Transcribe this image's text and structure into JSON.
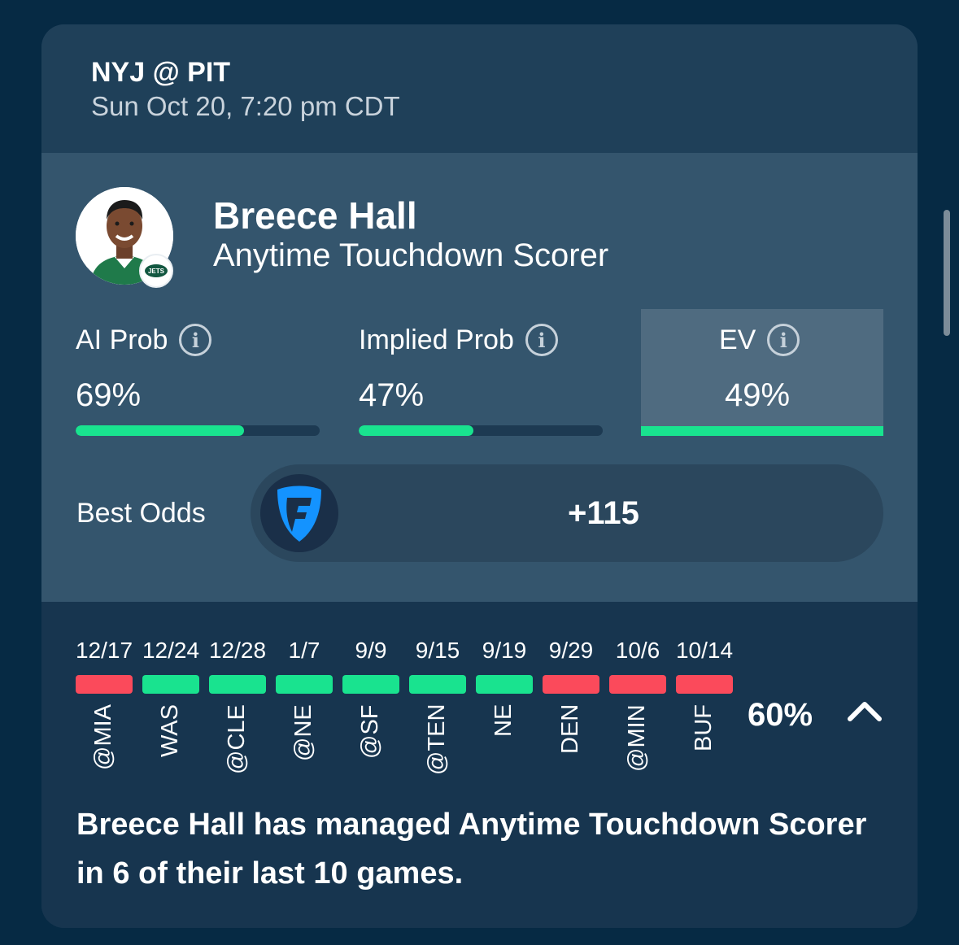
{
  "game": {
    "matchup": "NYJ @ PIT",
    "datetime": "Sun Oct 20, 7:20 pm CDT"
  },
  "player": {
    "name": "Breece Hall",
    "market": "Anytime Touchdown Scorer",
    "team_badge": "JETS"
  },
  "stats": {
    "ai_prob": {
      "label": "AI Prob",
      "value": "69%",
      "fraction": 0.69
    },
    "implied_prob": {
      "label": "Implied Prob",
      "value": "47%",
      "fraction": 0.47
    },
    "ev": {
      "label": "EV",
      "value": "49%",
      "fraction": 1.0
    }
  },
  "odds": {
    "label": "Best Odds",
    "value": "+115",
    "book_icon": "fanduel-shield-icon"
  },
  "history": {
    "games": [
      {
        "date": "12/17",
        "opponent": "@MIA",
        "result": "miss"
      },
      {
        "date": "12/24",
        "opponent": "WAS",
        "result": "hit"
      },
      {
        "date": "12/28",
        "opponent": "@CLE",
        "result": "hit"
      },
      {
        "date": "1/7",
        "opponent": "@NE",
        "result": "hit"
      },
      {
        "date": "9/9",
        "opponent": "@SF",
        "result": "hit"
      },
      {
        "date": "9/15",
        "opponent": "@TEN",
        "result": "hit"
      },
      {
        "date": "9/19",
        "opponent": "NE",
        "result": "hit"
      },
      {
        "date": "9/29",
        "opponent": "DEN",
        "result": "miss"
      },
      {
        "date": "10/6",
        "opponent": "@MIN",
        "result": "miss"
      },
      {
        "date": "10/14",
        "opponent": "BUF",
        "result": "miss"
      }
    ],
    "hit_rate": "60%",
    "summary": "Breece Hall has managed Anytime Touchdown Scorer in 6 of their last 10 games."
  },
  "colors": {
    "hit": "#19e38f",
    "miss": "#fb4a5b",
    "accent": "#19e38f"
  }
}
